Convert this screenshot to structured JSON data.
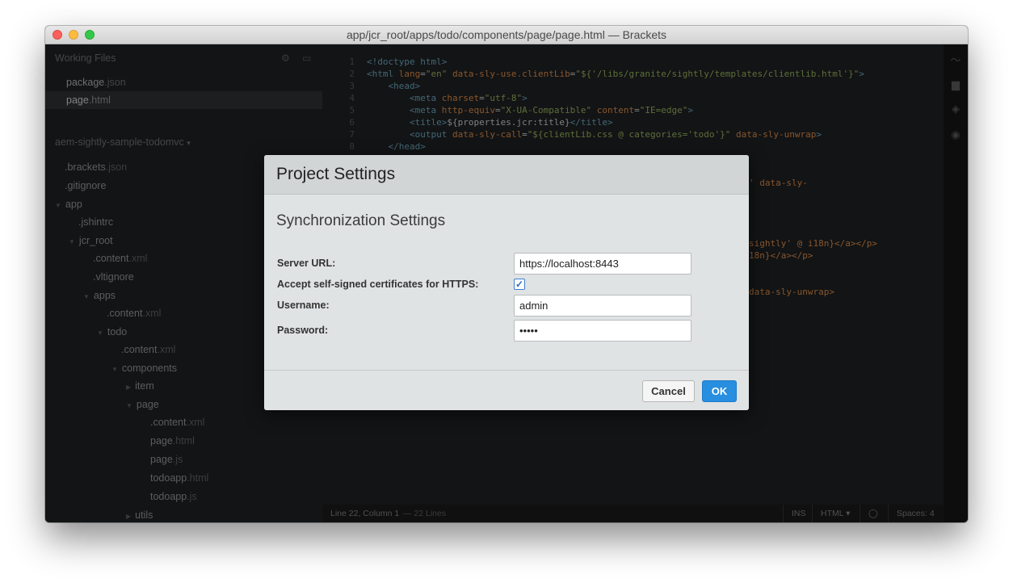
{
  "window": {
    "title": "app/jcr_root/apps/todo/components/page/page.html — Brackets"
  },
  "sidebar": {
    "working_files_title": "Working Files",
    "working_files": [
      {
        "name": "package",
        "ext": ".json"
      },
      {
        "name": "page",
        "ext": ".html"
      }
    ],
    "project_name": "aem-sightly-sample-todomvc",
    "tree": [
      {
        "name": ".brackets",
        "ext": ".json"
      },
      {
        "name": ".gitignore",
        "ext": ""
      },
      {
        "name": "app",
        "ext": ""
      },
      {
        "name": ".jshintrc",
        "ext": ""
      },
      {
        "name": "jcr_root",
        "ext": ""
      },
      {
        "name": ".content",
        "ext": ".xml"
      },
      {
        "name": ".vltignore",
        "ext": ""
      },
      {
        "name": "apps",
        "ext": ""
      },
      {
        "name": ".content",
        "ext": ".xml"
      },
      {
        "name": "todo",
        "ext": ""
      },
      {
        "name": ".content",
        "ext": ".xml"
      },
      {
        "name": "components",
        "ext": ""
      },
      {
        "name": "item",
        "ext": ""
      },
      {
        "name": "page",
        "ext": ""
      },
      {
        "name": ".content",
        "ext": ".xml"
      },
      {
        "name": "page",
        "ext": ".html"
      },
      {
        "name": "page",
        "ext": ".js"
      },
      {
        "name": "todoapp",
        "ext": ".html"
      },
      {
        "name": "todoapp",
        "ext": ".js"
      },
      {
        "name": "utils",
        "ext": ""
      }
    ]
  },
  "editor": {
    "line_numbers": [
      "1",
      "2",
      "3",
      "4",
      "5",
      "6",
      "7",
      "8"
    ],
    "fragments": {
      "frag1": "' data-sly-",
      "frag2": "sightly' @ i18n}</a></p>",
      "frag3": "18n}</a></p>",
      "frag4": "data-sly-unwrap>"
    }
  },
  "statusbar": {
    "position": "Line 22, Column 1",
    "lines": "— 22 Lines",
    "mode": "INS",
    "language": "HTML",
    "spaces": "Spaces: 4"
  },
  "dialog": {
    "title": "Project Settings",
    "section_title": "Synchronization Settings",
    "server_url_label": "Server URL:",
    "server_url_value": "https://localhost:8443",
    "accept_label": "Accept self-signed certificates for HTTPS:",
    "accept_checked": true,
    "username_label": "Username:",
    "username_value": "admin",
    "password_label": "Password:",
    "password_value": "admin",
    "cancel_label": "Cancel",
    "ok_label": "OK"
  }
}
